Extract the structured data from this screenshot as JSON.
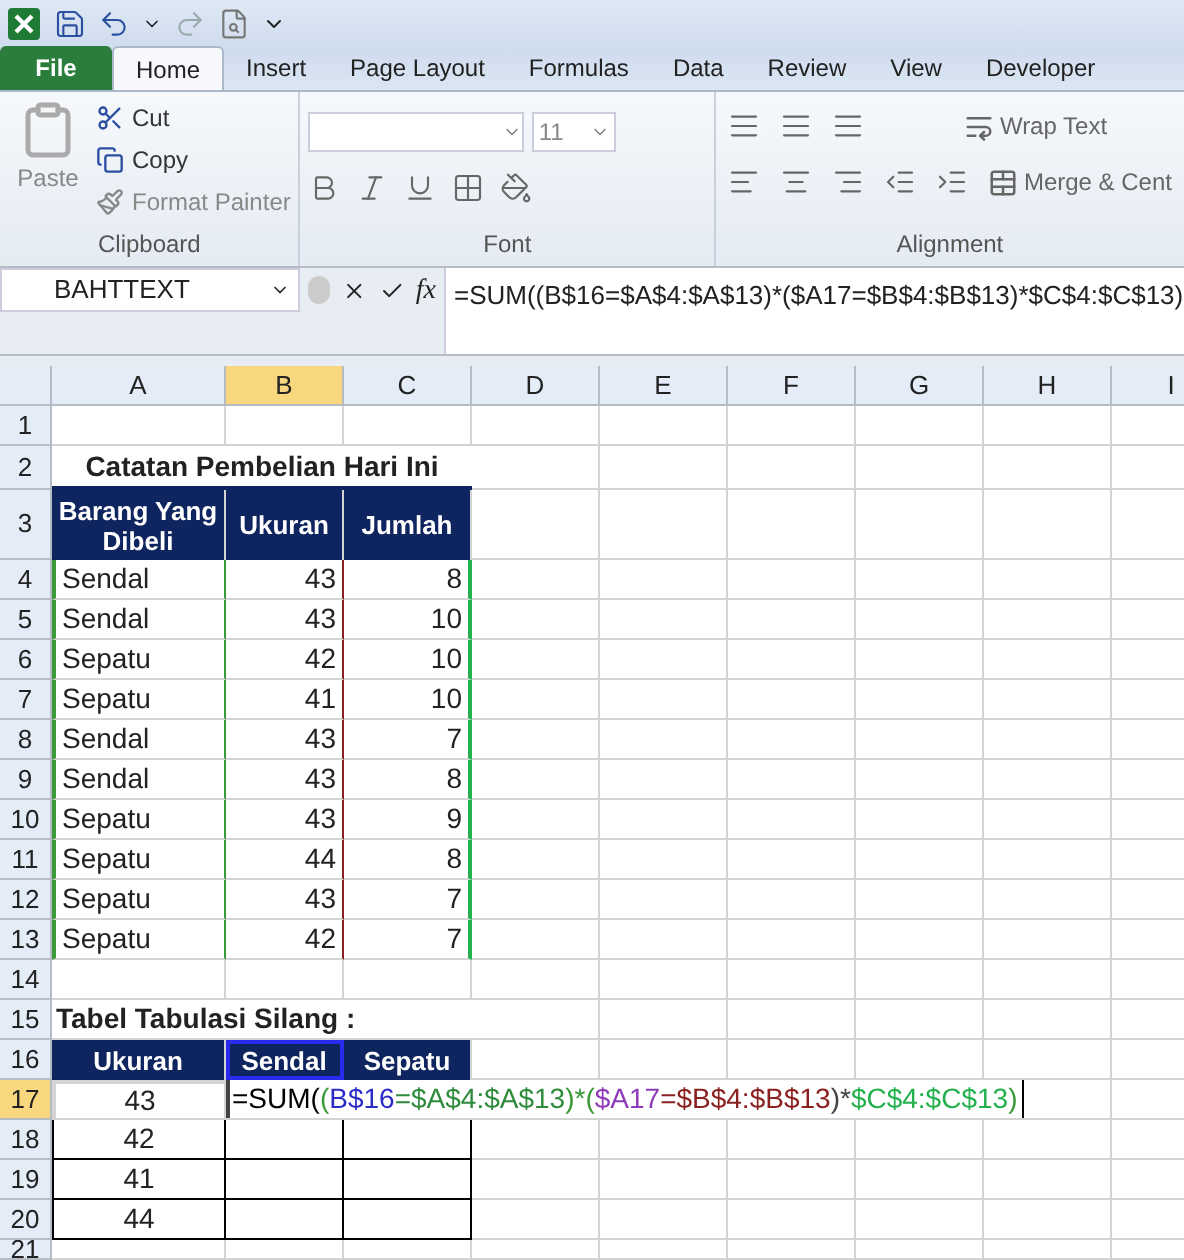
{
  "ribbon_tabs": [
    {
      "label": "File",
      "kind": "file",
      "selected": false
    },
    {
      "label": "Home",
      "kind": "tab",
      "selected": true
    },
    {
      "label": "Insert",
      "kind": "tab",
      "selected": false
    },
    {
      "label": "Page Layout",
      "kind": "tab",
      "selected": false
    },
    {
      "label": "Formulas",
      "kind": "tab",
      "selected": false
    },
    {
      "label": "Data",
      "kind": "tab",
      "selected": false
    },
    {
      "label": "Review",
      "kind": "tab",
      "selected": false
    },
    {
      "label": "View",
      "kind": "tab",
      "selected": false
    },
    {
      "label": "Developer",
      "kind": "tab",
      "selected": false
    }
  ],
  "clipboard": {
    "paste": "Paste",
    "cut": "Cut",
    "copy": "Copy",
    "format_painter": "Format Painter",
    "group": "Clipboard"
  },
  "font": {
    "size": "11",
    "group": "Font"
  },
  "alignment": {
    "wrap_text": "Wrap Text",
    "merge": "Merge & Cent",
    "group": "Alignment"
  },
  "formula_bar": {
    "name_box": "BAHTTEXT",
    "function_label": "fx",
    "formula": "=SUM((B$16=$A$4:$A$13)*($A17=$B$4:$B$13)*$C$4:$C$13)"
  },
  "columns": [
    {
      "label": "A",
      "selected": false
    },
    {
      "label": "B",
      "selected": true
    },
    {
      "label": "C",
      "selected": false
    },
    {
      "label": "D",
      "selected": false
    },
    {
      "label": "E",
      "selected": false
    },
    {
      "label": "F",
      "selected": false
    },
    {
      "label": "G",
      "selected": false
    },
    {
      "label": "H",
      "selected": false
    },
    {
      "label": "I",
      "selected": false
    }
  ],
  "rows": [
    {
      "number": "1",
      "kind": "blank",
      "selected": false,
      "cells": []
    },
    {
      "number": "2",
      "kind": "title",
      "selected": false,
      "cells": [
        "Catatan Pembelian Hari Ini"
      ]
    },
    {
      "number": "3",
      "kind": "header",
      "selected": false,
      "cells": [
        "Barang Yang Dibeli",
        "Ukuran",
        "Jumlah"
      ]
    },
    {
      "number": "4",
      "kind": "list",
      "selected": false,
      "cells": [
        "Sendal",
        "43",
        "8"
      ]
    },
    {
      "number": "5",
      "kind": "list",
      "selected": false,
      "cells": [
        "Sendal",
        "43",
        "10"
      ]
    },
    {
      "number": "6",
      "kind": "list",
      "selected": false,
      "cells": [
        "Sepatu",
        "42",
        "10"
      ]
    },
    {
      "number": "7",
      "kind": "list",
      "selected": false,
      "cells": [
        "Sepatu",
        "41",
        "10"
      ]
    },
    {
      "number": "8",
      "kind": "list",
      "selected": false,
      "cells": [
        "Sendal",
        "43",
        "7"
      ]
    },
    {
      "number": "9",
      "kind": "list",
      "selected": false,
      "cells": [
        "Sendal",
        "43",
        "8"
      ]
    },
    {
      "number": "10",
      "kind": "list",
      "selected": false,
      "cells": [
        "Sepatu",
        "43",
        "9"
      ]
    },
    {
      "number": "11",
      "kind": "list",
      "selected": false,
      "cells": [
        "Sepatu",
        "44",
        "8"
      ]
    },
    {
      "number": "12",
      "kind": "list",
      "selected": false,
      "cells": [
        "Sepatu",
        "43",
        "7"
      ]
    },
    {
      "number": "13",
      "kind": "list",
      "selected": false,
      "cells": [
        "Sepatu",
        "42",
        "7"
      ]
    },
    {
      "number": "14",
      "kind": "blank",
      "selected": false,
      "cells": []
    },
    {
      "number": "15",
      "kind": "caption",
      "selected": false,
      "cells": [
        "Tabel Tabulasi Silang :"
      ]
    },
    {
      "number": "16",
      "kind": "header",
      "selected": false,
      "cells": [
        "Ukuran",
        "Sendal",
        "Sepatu"
      ]
    },
    {
      "number": "17",
      "kind": "edit",
      "selected": true,
      "cells": [
        "43"
      ],
      "formula_parts": [
        {
          "text": "=SUM(",
          "color": "#000000"
        },
        {
          "text": "(",
          "color": "#3a9a3a"
        },
        {
          "text": "B$16",
          "color": "#2b2bc8"
        },
        {
          "text": "=$A$4:$A$13",
          "color": "#2e8b3c"
        },
        {
          "text": ")*(",
          "color": "#3a9a3a"
        },
        {
          "text": "$A17",
          "color": "#8e3ab8"
        },
        {
          "text": "=$B$4:$B$13",
          "color": "#8b2020"
        },
        {
          "text": ")*",
          "color": "#444444"
        },
        {
          "text": "$C$4:$C$13",
          "color": "#22b14c"
        },
        {
          "text": ")",
          "color": "#3a9a3a"
        }
      ]
    },
    {
      "number": "18",
      "kind": "cross",
      "selected": false,
      "cells": [
        "42"
      ]
    },
    {
      "number": "19",
      "kind": "cross",
      "selected": false,
      "cells": [
        "41"
      ]
    },
    {
      "number": "20",
      "kind": "cross",
      "selected": false,
      "cells": [
        "44"
      ]
    },
    {
      "number": "21",
      "kind": "blank",
      "selected": false,
      "cells": []
    }
  ]
}
